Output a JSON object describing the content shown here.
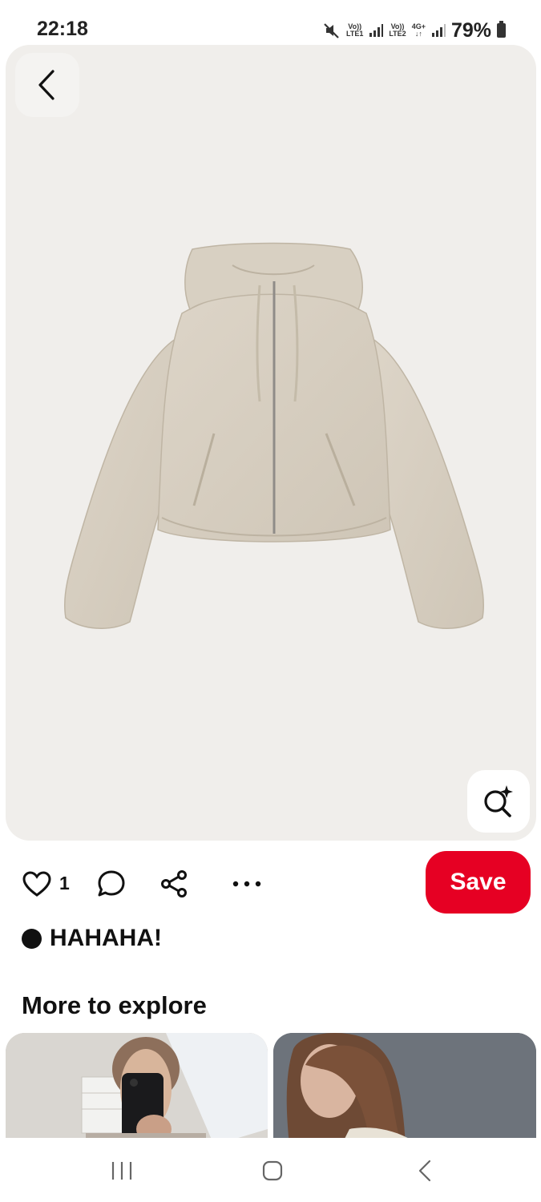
{
  "status_bar": {
    "time": "22:18",
    "sim1_top": "Vo))",
    "sim1_bottom": "LTE1",
    "sim2_top": "Vo))",
    "sim2_bottom": "LTE2",
    "network": "4G+",
    "battery": "79%"
  },
  "pin": {
    "image_subject": "beige zip-up hooded jacket"
  },
  "actions": {
    "like_count": "1",
    "save_label": "Save"
  },
  "board": {
    "name": "HAHAHA!"
  },
  "explore": {
    "title": "More to explore"
  },
  "colors": {
    "accent": "#e60023",
    "image_background": "#f0eeeb"
  }
}
